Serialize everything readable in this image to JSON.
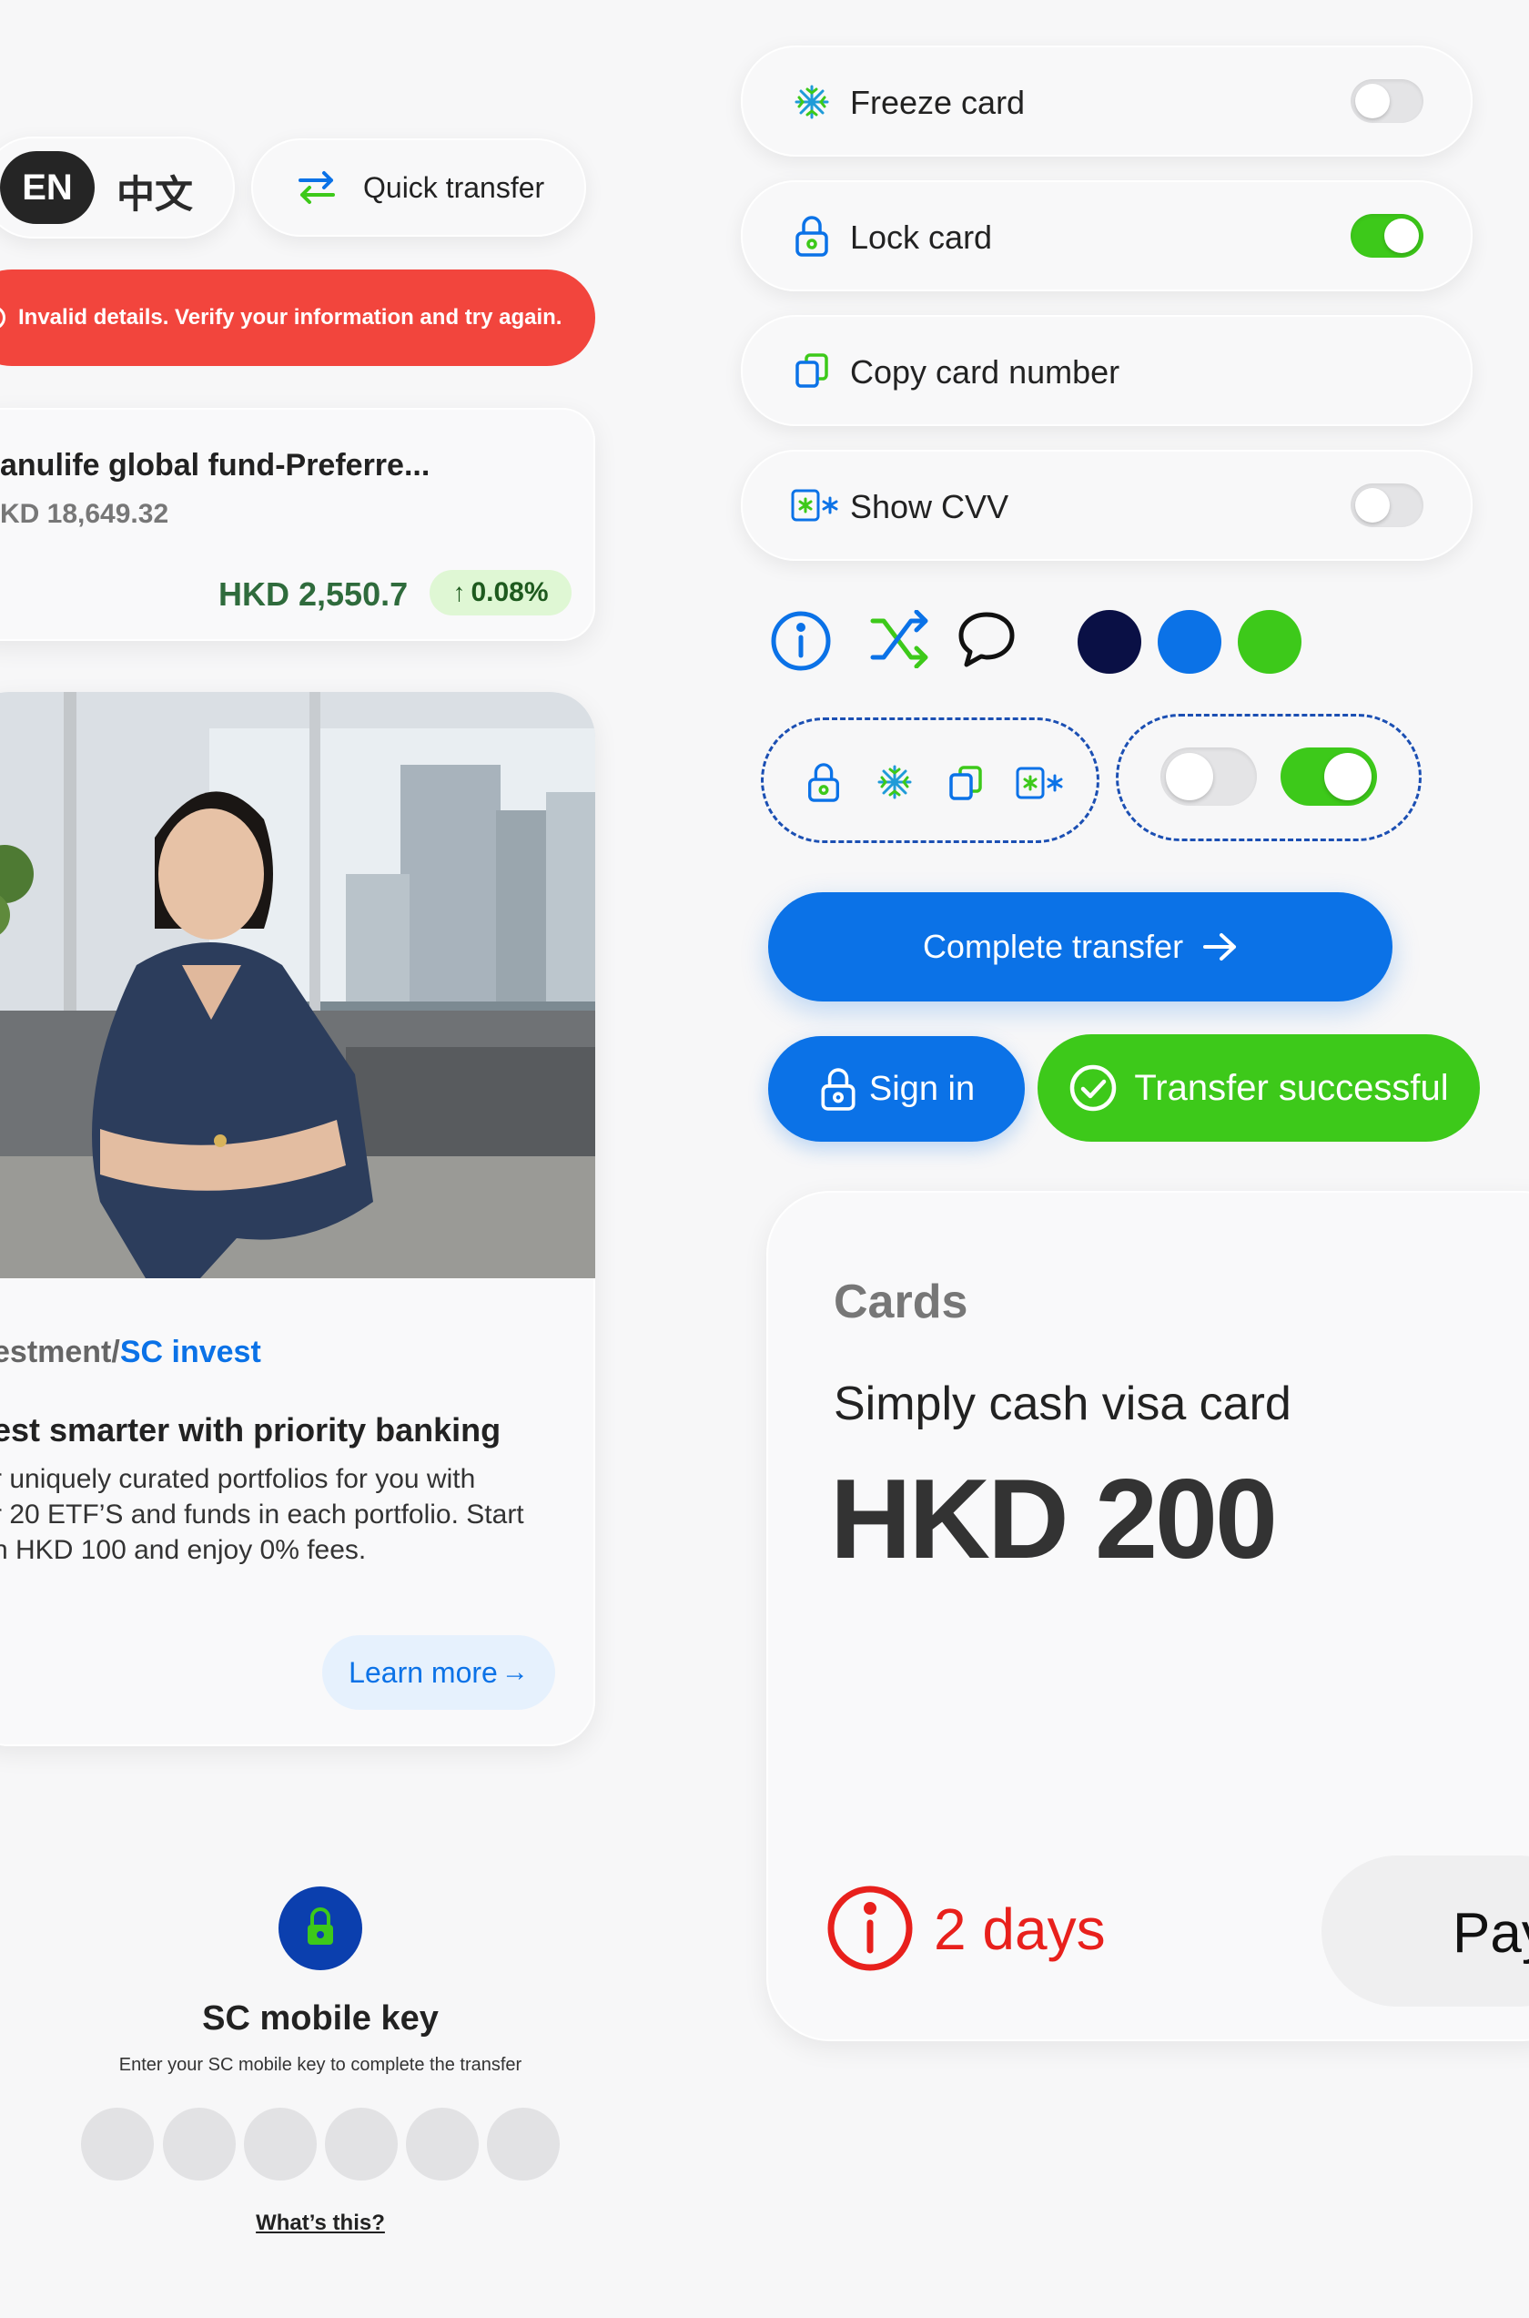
{
  "language": {
    "active": "EN",
    "alternate": "中文"
  },
  "quick_transfer": {
    "label": "Quick transfer"
  },
  "error_banner": {
    "message": "Invalid details. Verify your information and try again."
  },
  "fund_card": {
    "name": "anulife global fund-Preferre...",
    "balance": "KD 18,649.32",
    "value": "HKD 2,550.7",
    "change": "0.08%"
  },
  "promo": {
    "breadcrumb_prefix": "estment/",
    "breadcrumb_link": "SC invest",
    "title": "est smarter with priority banking",
    "body_lines": [
      "r uniquely curated portfolios for you with",
      "r 20 ETF’S and funds in each portfolio. Start",
      "n HKD 100 and enjoy 0% fees."
    ],
    "cta": "Learn more"
  },
  "mobile_key": {
    "title": "SC mobile key",
    "subtitle": "Enter your SC mobile key to complete the transfer",
    "pin_length": 6,
    "help_link": "What’s this?"
  },
  "card_controls": [
    {
      "label": "Freeze card",
      "icon": "snowflake-icon",
      "toggle": false
    },
    {
      "label": "Lock card",
      "icon": "lock-icon",
      "toggle": true
    },
    {
      "label": "Copy card number",
      "icon": "copy-icon",
      "toggle": null
    },
    {
      "label": "Show CVV",
      "icon": "cvv-icon",
      "toggle": false
    }
  ],
  "palette": {
    "navy": "#0a1045",
    "blue": "#0b72e7",
    "green": "#3dc91a",
    "red": "#f2453d"
  },
  "buttons": {
    "complete_transfer": "Complete transfer",
    "sign_in": "Sign in",
    "transfer_successful": "Transfer successful"
  },
  "cards_panel": {
    "heading": "Cards",
    "card_name": "Simply cash visa card",
    "amount": "HKD 200",
    "due": "2 days",
    "pay_label": "Pay"
  }
}
